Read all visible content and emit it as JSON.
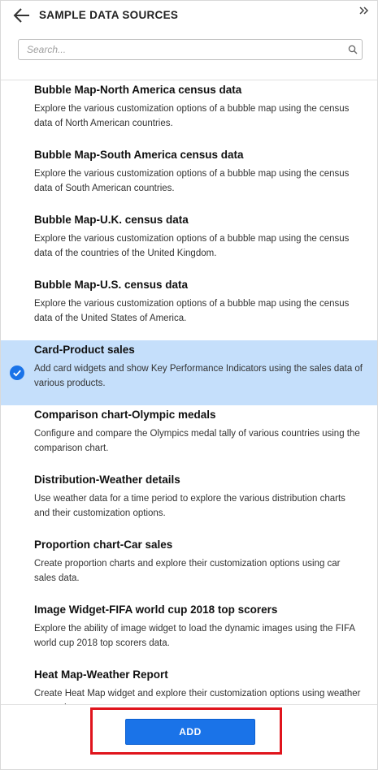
{
  "header": {
    "title": "SAMPLE DATA SOURCES",
    "back_icon": "arrow-left-icon",
    "collapse_icon": "double-chevron-right-icon"
  },
  "search": {
    "placeholder": "Search...",
    "value": "",
    "icon": "search-icon"
  },
  "items": [
    {
      "title": "Bubble Map-North America census data",
      "description": "Explore the various customization options of a bubble map using the census data of North American countries.",
      "selected": false
    },
    {
      "title": "Bubble Map-South America census data",
      "description": "Explore the various customization options of a bubble map using the census data of South American countries.",
      "selected": false
    },
    {
      "title": "Bubble Map-U.K. census data",
      "description": "Explore the various customization options of a bubble map using the census data of the countries of the United Kingdom.",
      "selected": false
    },
    {
      "title": "Bubble Map-U.S. census data",
      "description": "Explore the various customization options of a bubble map using the census data of the United States of America.",
      "selected": false
    },
    {
      "title": "Card-Product sales",
      "description": "Add card widgets and show Key Performance Indicators using the sales data of various products.",
      "selected": true
    },
    {
      "title": "Comparison chart-Olympic medals",
      "description": "Configure and compare the Olympics medal tally of various countries using the comparison chart.",
      "selected": false
    },
    {
      "title": "Distribution-Weather details",
      "description": "Use weather data for a time period to explore the various distribution charts and their customization options.",
      "selected": false
    },
    {
      "title": "Proportion chart-Car sales",
      "description": "Create proportion charts and explore their customization options using car sales data.",
      "selected": false
    },
    {
      "title": "Image Widget-FIFA world cup 2018 top scorers",
      "description": "Explore the ability of image widget to load the dynamic images using the FIFA world cup 2018 top scorers data.",
      "selected": false
    },
    {
      "title": "Heat Map-Weather Report",
      "description": "Create Heat Map widget and explore their customization options using weather report data.",
      "selected": false
    }
  ],
  "footer": {
    "add_label": "ADD"
  },
  "colors": {
    "accent": "#1a73e8",
    "selected_bg": "#c5dffb",
    "highlight": "#e0141c"
  }
}
